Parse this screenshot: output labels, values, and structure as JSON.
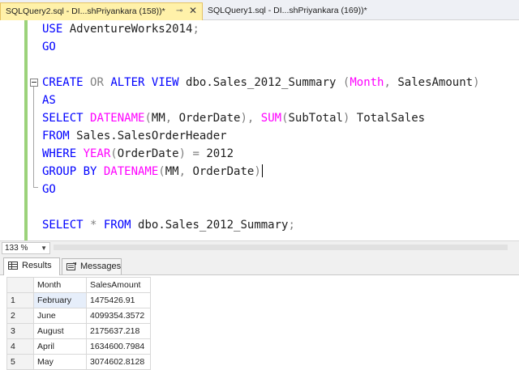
{
  "tabs": [
    {
      "label": "SQLQuery2.sql - DI...shPriyankara (158))*",
      "active": true
    },
    {
      "label": "SQLQuery1.sql - DI...shPriyankara (169))*",
      "active": false
    }
  ],
  "editor": {
    "db_name": "AdventureWorks2014",
    "view_name": "dbo.Sales_2012_Summary",
    "col1": "Month",
    "col2": "SalesAmount",
    "date_col": "OrderDate",
    "subtotal_col": "SubTotal",
    "alias": "TotalSales",
    "table": "Sales.SalesOrderHeader",
    "year": "2012",
    "mm": "MM"
  },
  "zoom": {
    "value": "133 %"
  },
  "results_tabs": {
    "results": "Results",
    "messages": "Messages"
  },
  "grid": {
    "columns": [
      "Month",
      "SalesAmount"
    ],
    "rows": [
      {
        "num": "1",
        "month": "February",
        "amount": "1475426.91"
      },
      {
        "num": "2",
        "month": "June",
        "amount": "4099354.3572"
      },
      {
        "num": "3",
        "month": "August",
        "amount": "2175637.218"
      },
      {
        "num": "4",
        "month": "April",
        "amount": "1634600.7984"
      },
      {
        "num": "5",
        "month": "May",
        "amount": "3074602.8128"
      }
    ]
  }
}
